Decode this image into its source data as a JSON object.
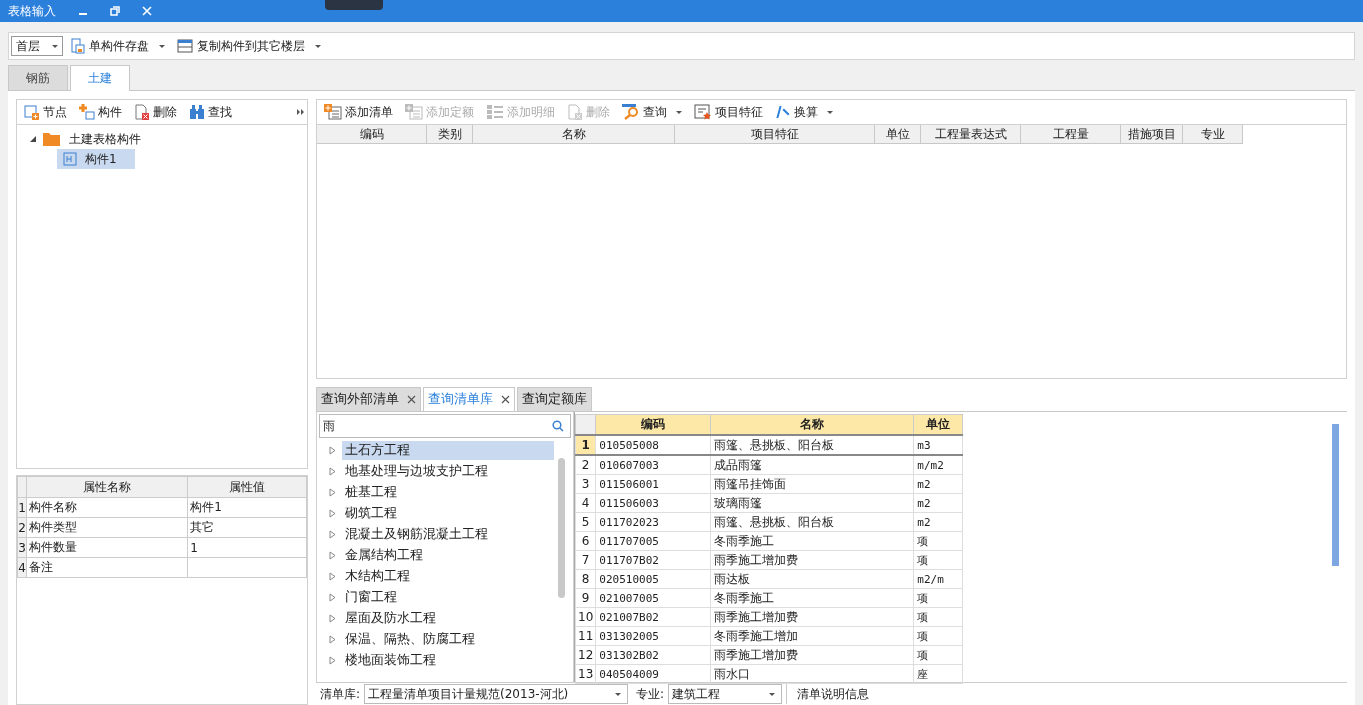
{
  "window": {
    "title": "表格输入"
  },
  "toolbar": {
    "floor": "首层",
    "buttons": [
      {
        "label": "单构件存盘",
        "menu": true
      },
      {
        "label": "复制构件到其它楼层",
        "menu": true
      }
    ]
  },
  "tabs": [
    {
      "label": "钢筋",
      "selected": false
    },
    {
      "label": "土建",
      "selected": true
    }
  ],
  "left_toolbar": [
    {
      "label": "节点"
    },
    {
      "label": "构件"
    },
    {
      "label": "删除"
    },
    {
      "label": "查找"
    }
  ],
  "tree": [
    {
      "label": "土建表格构件",
      "expanded": true,
      "selected": false,
      "children": [
        {
          "label": "构件1",
          "selected": true
        }
      ]
    }
  ],
  "properties": {
    "columns": [
      "属性名称",
      "属性值"
    ],
    "rows": [
      {
        "index": "1",
        "name": "构件名称",
        "value": "构件1"
      },
      {
        "index": "2",
        "name": "构件类型",
        "value": "其它"
      },
      {
        "index": "3",
        "name": "构件数量",
        "value": "1"
      },
      {
        "index": "4",
        "name": "备注"
      }
    ]
  },
  "list_toolbar": [
    {
      "label": "添加清单",
      "disabled": false,
      "menu": false
    },
    {
      "label": "添加定额",
      "disabled": true,
      "menu": false
    },
    {
      "label": "添加明细",
      "disabled": true,
      "menu": false
    },
    {
      "label": "删除",
      "disabled": true,
      "menu": false
    },
    {
      "label": "查询",
      "disabled": false,
      "menu": true
    },
    {
      "label": "项目特征",
      "disabled": false,
      "menu": false
    },
    {
      "label": "换算",
      "disabled": false,
      "menu": true
    }
  ],
  "list_table": {
    "columns": [
      "编码",
      "类别",
      "名称",
      "项目特征",
      "单位",
      "工程量表达式",
      "工程量",
      "措施项目",
      "专业"
    ]
  },
  "query_tabs": [
    {
      "label": "查询外部清单",
      "selected": false,
      "closable": true
    },
    {
      "label": "查询清单库",
      "selected": true,
      "closable": true
    },
    {
      "label": "查询定额库",
      "selected": false,
      "closable": false
    }
  ],
  "search": {
    "value": "雨"
  },
  "categories": [
    {
      "label": "土石方工程",
      "selected": true
    },
    {
      "label": "地基处理与边坡支护工程",
      "selected": false
    },
    {
      "label": "桩基工程",
      "selected": false
    },
    {
      "label": "砌筑工程",
      "selected": false
    },
    {
      "label": "混凝土及钢筋混凝土工程",
      "selected": false
    },
    {
      "label": "金属结构工程",
      "selected": false
    },
    {
      "label": "木结构工程",
      "selected": false
    },
    {
      "label": "门窗工程",
      "selected": false
    },
    {
      "label": "屋面及防水工程",
      "selected": false
    },
    {
      "label": "保温、隔热、防腐工程",
      "selected": false
    },
    {
      "label": "楼地面装饰工程",
      "selected": false
    }
  ],
  "results": {
    "columns": [
      "编码",
      "名称",
      "单位"
    ],
    "rows": [
      {
        "index": "1",
        "code": "010505008",
        "name": "雨篷、悬挑板、阳台板",
        "unit": "m3",
        "selected": true
      },
      {
        "index": "2",
        "code": "010607003",
        "name": "成品雨篷",
        "unit": "m/m2",
        "selected": false
      },
      {
        "index": "3",
        "code": "011506001",
        "name": "雨篷吊挂饰面",
        "unit": "m2",
        "selected": false
      },
      {
        "index": "4",
        "code": "011506003",
        "name": "玻璃雨篷",
        "unit": "m2",
        "selected": false
      },
      {
        "index": "5",
        "code": "011702023",
        "name": "雨篷、悬挑板、阳台板",
        "unit": "m2",
        "selected": false
      },
      {
        "index": "6",
        "code": "011707005",
        "name": "冬雨季施工",
        "unit": "项",
        "selected": false
      },
      {
        "index": "7",
        "code": "011707B02",
        "name": "雨季施工增加费",
        "unit": "项",
        "selected": false
      },
      {
        "index": "8",
        "code": "020510005",
        "name": "雨达板",
        "unit": "m2/m",
        "selected": false
      },
      {
        "index": "9",
        "code": "021007005",
        "name": "冬雨季施工",
        "unit": "项",
        "selected": false
      },
      {
        "index": "10",
        "code": "021007B02",
        "name": "雨季施工增加费",
        "unit": "项",
        "selected": false
      },
      {
        "index": "11",
        "code": "031302005",
        "name": "冬雨季施工增加",
        "unit": "项",
        "selected": false
      },
      {
        "index": "12",
        "code": "031302B02",
        "name": "雨季施工增加费",
        "unit": "项",
        "selected": false
      },
      {
        "index": "13",
        "code": "040504009",
        "name": "雨水口",
        "unit": "座",
        "selected": false
      }
    ]
  },
  "footer": {
    "library_label": "清单库:",
    "library": "工程量清单项目计量规范(2013-河北)",
    "major_label": "专业:",
    "major": "建筑工程",
    "info_button": "清单说明信息"
  }
}
